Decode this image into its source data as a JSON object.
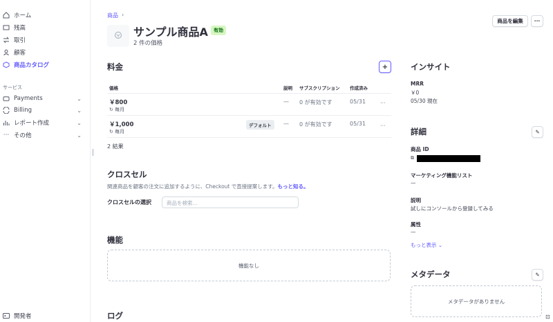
{
  "sidebar": {
    "items": [
      {
        "label": "ホーム",
        "icon": "home-icon"
      },
      {
        "label": "残高",
        "icon": "balance-icon"
      },
      {
        "label": "取引",
        "icon": "transactions-icon"
      },
      {
        "label": "顧客",
        "icon": "customers-icon"
      },
      {
        "label": "商品カタログ",
        "icon": "catalog-icon"
      }
    ],
    "section_label": "サービス",
    "services": [
      {
        "label": "Payments",
        "icon": "payments-icon"
      },
      {
        "label": "Billing",
        "icon": "billing-icon"
      },
      {
        "label": "レポート作成",
        "icon": "report-icon"
      },
      {
        "label": "その他",
        "icon": "more-icon"
      }
    ],
    "developer": "開発者"
  },
  "breadcrumb": {
    "link": "商品",
    "sep": "›"
  },
  "product": {
    "title": "サンプル商品A",
    "status": "有効",
    "subtitle": "2 件の価格"
  },
  "header_actions": {
    "edit": "商品を編集",
    "more": "···"
  },
  "pricing": {
    "title": "料金",
    "add": "+",
    "columns": {
      "price": "価格",
      "desc": "説明",
      "subs": "サブスクリプション",
      "created": "作成済み"
    },
    "rows": [
      {
        "price": "￥800",
        "interval": "毎月",
        "badge": "",
        "desc": "—",
        "subs": "0 が有効です",
        "created": "05/31",
        "more": "···"
      },
      {
        "price": "￥1,000",
        "interval": "毎月",
        "badge": "デフォルト",
        "desc": "—",
        "subs": "0 が有効です",
        "created": "05/31",
        "more": "···"
      }
    ],
    "result_count": "2 結果"
  },
  "crosssell": {
    "title": "クロスセル",
    "desc": "関連商品を顧客の注文に追加するように、Checkout で直接提案します。",
    "learn_more": "もっと知る。",
    "select_label": "クロスセルの選択",
    "search_placeholder": "商品を検索..."
  },
  "features": {
    "title": "機能",
    "empty": "機能なし"
  },
  "log": {
    "title": "ログ"
  },
  "insights": {
    "title": "インサイト",
    "mrr_label": "MRR",
    "mrr_value": "￥0",
    "mrr_date": "05/30 現在"
  },
  "details": {
    "title": "詳細",
    "edit_icon": "pencil-icon",
    "id_label": "商品 ID",
    "marketing_label": "マーケティング機能リスト",
    "marketing_value": "—",
    "desc_label": "説明",
    "desc_value": "試しにコンソールから登録してみる",
    "attr_label": "属性",
    "attr_value": "—",
    "show_more": "もっと表示"
  },
  "metadata": {
    "title": "メタデータ",
    "empty": "メタデータがありません"
  },
  "colors": {
    "accent": "#635bff",
    "badge_bg": "#d7f7c2",
    "badge_fg": "#05690d"
  }
}
